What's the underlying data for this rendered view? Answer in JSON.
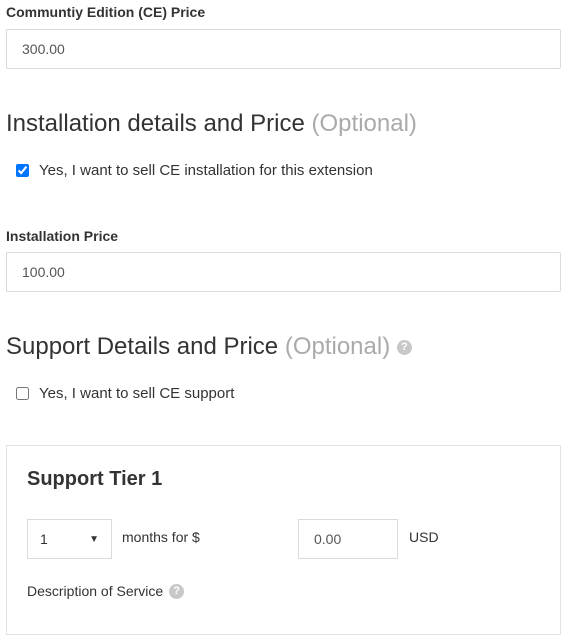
{
  "ce_price": {
    "label": "Communtiy Edition (CE) Price",
    "value": "300.00"
  },
  "installation": {
    "title": "Installation details and Price",
    "optional": "(Optional)",
    "checkbox_label": "Yes, I want to sell CE installation for this extension",
    "checked": true,
    "price_label": "Installation Price",
    "price_value": "100.00"
  },
  "support": {
    "title": "Support Details and Price",
    "optional": "(Optional)",
    "checkbox_label": "Yes, I want to sell CE support",
    "checked": false,
    "tier": {
      "title": "Support Tier 1",
      "months_selected": "1",
      "months_text": "months for $",
      "price_value": "0.00",
      "currency": "USD",
      "description_label": "Description of Service"
    }
  },
  "icons": {
    "help": "question-circle-icon",
    "caret": "caret-down-icon"
  }
}
